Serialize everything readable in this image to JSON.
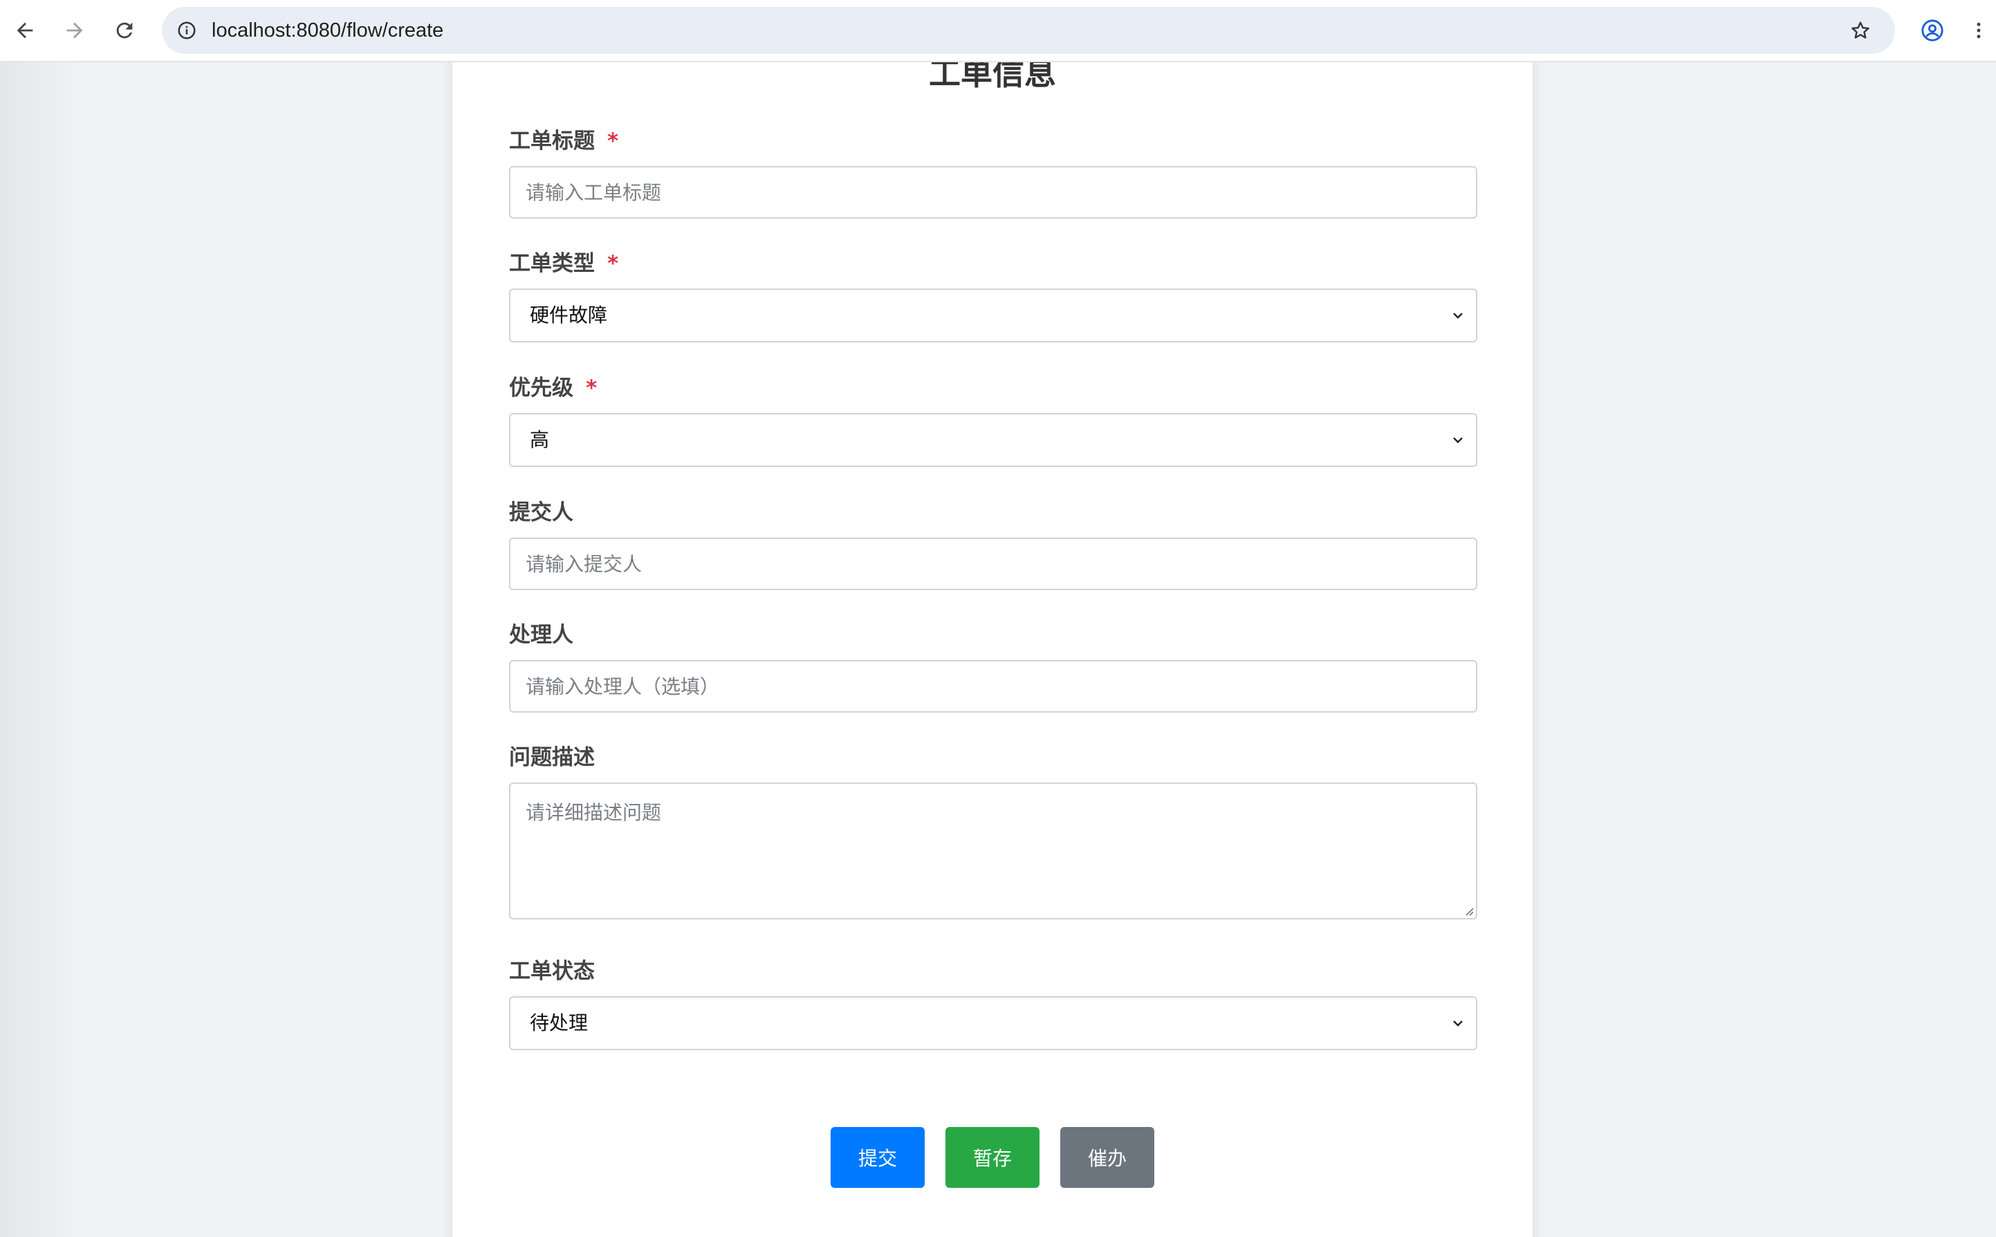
{
  "browser": {
    "url": "localhost:8080/flow/create"
  },
  "form": {
    "title": "工单信息",
    "fields": {
      "ticket_title": {
        "label": "工单标题",
        "required_mark": "*",
        "placeholder": "请输入工单标题",
        "value": ""
      },
      "ticket_type": {
        "label": "工单类型",
        "required_mark": "*",
        "selected": "硬件故障"
      },
      "priority": {
        "label": "优先级",
        "required_mark": "*",
        "selected": "高"
      },
      "submitter": {
        "label": "提交人",
        "placeholder": "请输入提交人",
        "value": ""
      },
      "handler": {
        "label": "处理人",
        "placeholder": "请输入处理人（选填）",
        "value": ""
      },
      "description": {
        "label": "问题描述",
        "placeholder": "请详细描述问题",
        "value": ""
      },
      "status": {
        "label": "工单状态",
        "selected": "待处理"
      }
    },
    "buttons": {
      "submit": "提交",
      "save_draft": "暂存",
      "urge": "催办"
    }
  },
  "colors": {
    "submit_button": "#007bff",
    "save_draft_button": "#28a745",
    "urge_button": "#6c757d",
    "required_star": "#dc3545"
  },
  "icons": {
    "back": "arrow-left-icon",
    "forward": "arrow-right-icon",
    "reload": "reload-icon",
    "site_info": "info-circle-icon",
    "bookmark": "star-icon",
    "profile": "profile-icon",
    "menu": "kebab-menu-icon",
    "select_chevron": "chevron-down-icon"
  }
}
